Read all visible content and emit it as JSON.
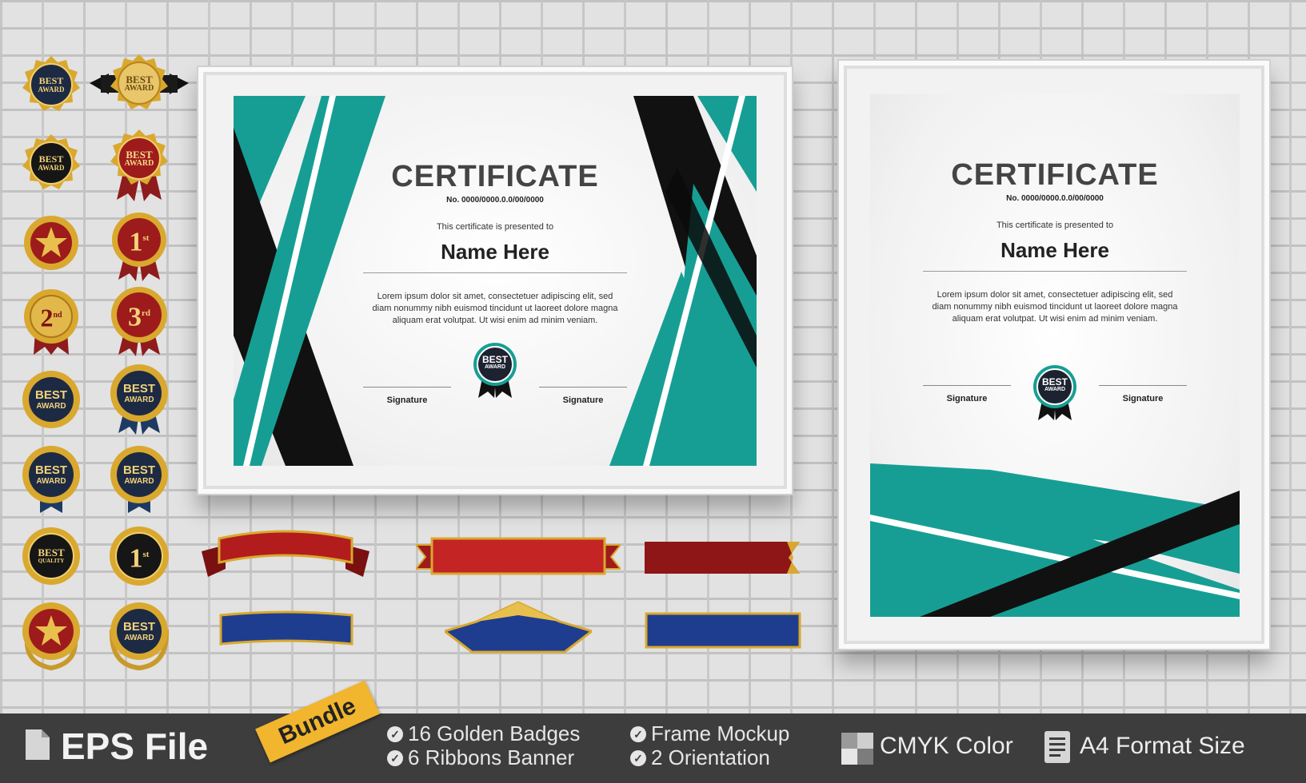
{
  "certificate": {
    "title": "CERTIFICATE",
    "number": "No. 0000/0000.0.0/00/0000",
    "presented": "This certificate is presented to",
    "name": "Name Here",
    "lorem_1": "Lorem ipsum dolor sit amet, consectetuer adipiscing elit, sed",
    "lorem_2": "diam nonummy nibh euismod tincidunt ut laoreet dolore magna",
    "lorem_3": "aliquam erat volutpat. Ut wisi enim ad minim veniam.",
    "signature": "Signature",
    "seal_1": "BEST",
    "seal_2": "AWARD"
  },
  "badges": {
    "best": "BEST",
    "award": "AWARD",
    "quality": "QUALITY",
    "first": "1",
    "second": "2",
    "third": "3",
    "st": "st",
    "nd": "nd",
    "rd": "rd"
  },
  "footer": {
    "eps": "EPS File",
    "bundle": "Bundle",
    "feature_1": "16 Golden Badges",
    "feature_2": "6  Ribbons Banner",
    "feature_3": "Frame Mockup",
    "feature_4": "2 Orientation",
    "cmyk": "CMYK Color",
    "a4": "A4 Format Size"
  },
  "colors": {
    "teal": "#179e94",
    "black": "#111111",
    "gold": "#d9a82e",
    "navy": "#1d2a44",
    "red": "#9e1b1b",
    "blue": "#1f3d8f",
    "footer_bg": "#3d3d3d",
    "bundle_tag": "#f1b52e"
  },
  "icons": [
    "file-icon",
    "check-circle-icon",
    "cmyk-swatch-icon",
    "document-icon"
  ]
}
